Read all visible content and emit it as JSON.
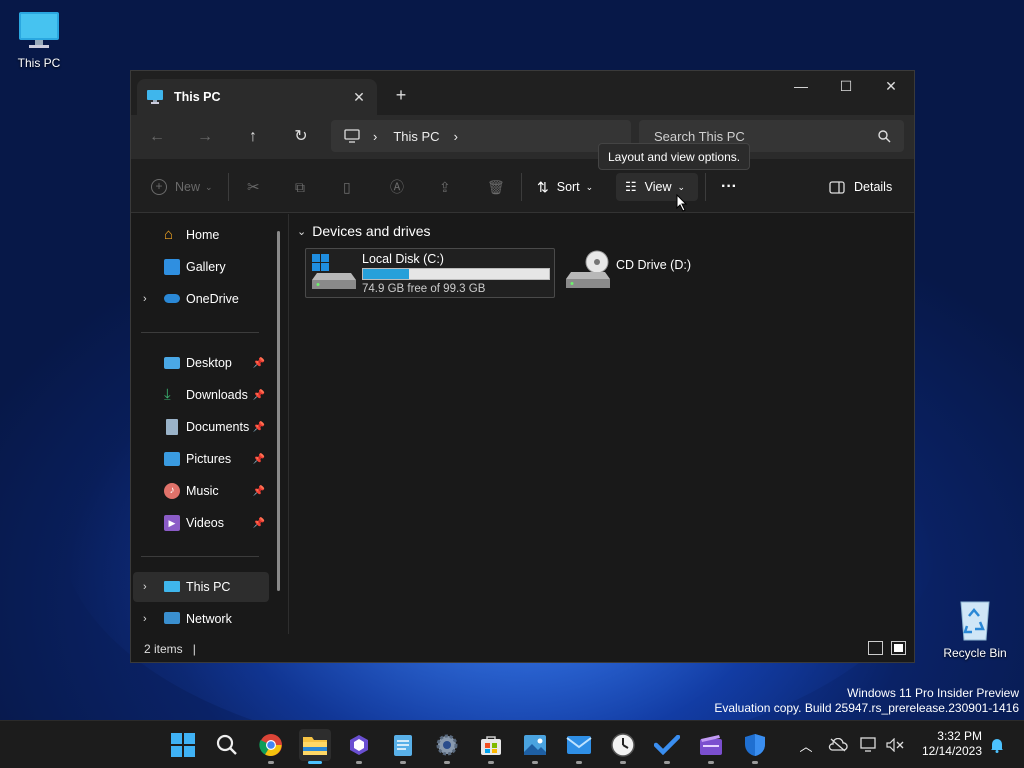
{
  "desktop": {
    "this_pc_label": "This PC",
    "recycle_bin_label": "Recycle Bin",
    "watermark_line1": "Windows 11 Pro Insider Preview",
    "watermark_line2": "Evaluation copy. Build 25947.rs_prerelease.230901-1416"
  },
  "window": {
    "tab_title": "This PC",
    "address": {
      "segments": [
        "This PC"
      ]
    },
    "search_placeholder": "Search This PC",
    "toolbar": {
      "new_label": "New",
      "sort_label": "Sort",
      "view_label": "View",
      "details_label": "Details"
    },
    "tooltip": "Layout and view options.",
    "sidebar": {
      "top": [
        "Home",
        "Gallery",
        "OneDrive"
      ],
      "pinned": [
        "Desktop",
        "Downloads",
        "Documents",
        "Pictures",
        "Music",
        "Videos"
      ],
      "bottom": [
        "This PC",
        "Network"
      ],
      "selected": "This PC"
    },
    "group_title": "Devices and drives",
    "drives": [
      {
        "name": "Local Disk (C:)",
        "free_text": "74.9 GB free of 99.3 GB",
        "used_fraction": 0.246
      },
      {
        "name": "CD Drive (D:)"
      }
    ],
    "status": "2 items"
  },
  "taskbar": {
    "pinned_apps": [
      "start-icon",
      "search-icon",
      "chrome-icon",
      "file-explorer-icon",
      "copilot-icon",
      "notepad-icon",
      "settings-icon",
      "store-icon",
      "photos-icon",
      "mail-icon",
      "clock-icon",
      "todo-icon",
      "clipchamp-icon",
      "defender-icon"
    ],
    "time": "3:32 PM",
    "date": "12/14/2023"
  },
  "colors": {
    "accent": "#4cc2ff",
    "drive_bar": "#26a0da"
  }
}
